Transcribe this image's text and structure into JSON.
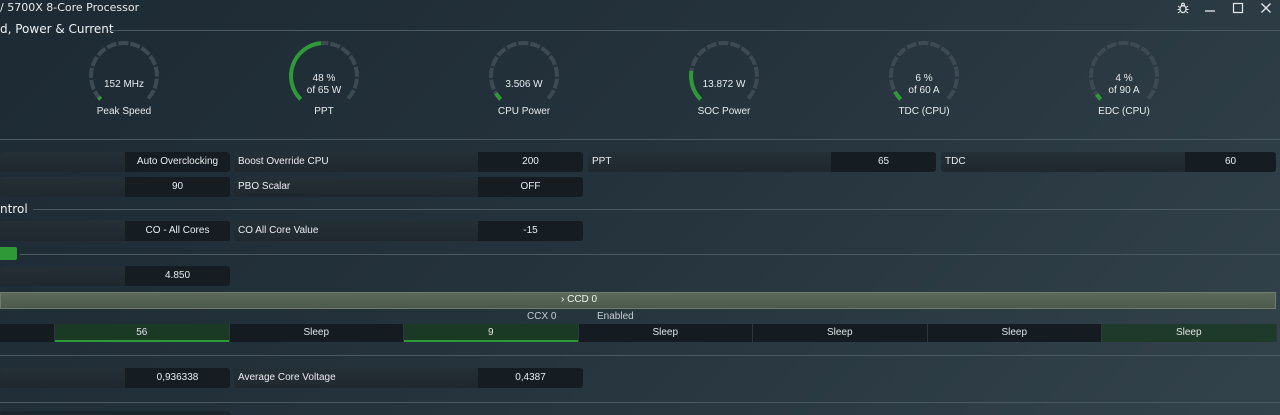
{
  "window": {
    "title": "/ 5700X 8-Core Processor",
    "icons": [
      "bug-icon",
      "minimize-icon",
      "maximize-icon",
      "close-icon"
    ]
  },
  "sections": {
    "speed_power": "d, Power & Current",
    "curve": "ntrol"
  },
  "gauges": [
    {
      "value": "152  MHz",
      "sub": "",
      "label": "Peak Speed",
      "fraction": 0.02
    },
    {
      "value": "48 %",
      "sub": "of 65 W",
      "label": "PPT",
      "fraction": 0.48
    },
    {
      "value": "3.506 W",
      "sub": "",
      "label": "CPU Power",
      "fraction": 0.05
    },
    {
      "value": "13.872 W",
      "sub": "",
      "label": "SOC Power",
      "fraction": 0.2
    },
    {
      "value": "6 %",
      "sub": "of 60 A",
      "label": "TDC (CPU)",
      "fraction": 0.06
    },
    {
      "value": "4 %",
      "sub": "of 90 A",
      "label": "EDC (CPU)",
      "fraction": 0.04
    }
  ],
  "rows": {
    "r1": {
      "auto_oc": "Auto Overclocking",
      "boost_label": "Boost Override CPU",
      "boost_value": "200",
      "ppt_label": "PPT",
      "ppt_value": "65",
      "tdc_label": "TDC",
      "tdc_value": "60"
    },
    "r2": {
      "left_value": "90",
      "pbo_label": "PBO Scalar",
      "pbo_value": "OFF"
    },
    "r3": {
      "co_mode": "CO - All Cores",
      "co_label": "CO All Core Value",
      "co_value": "-15"
    },
    "r4": {
      "enable_chip": "",
      "value": "4.850"
    },
    "r5": {
      "left_value": "0,936338",
      "avg_label": "Average Core Voltage",
      "avg_value": "0,4387"
    }
  },
  "ccd": {
    "title": "›  CCD 0",
    "ccx": "CCX 0",
    "status": "Enabled",
    "cores": [
      {
        "text": "",
        "load": 0
      },
      {
        "text": "56",
        "load": 1
      },
      {
        "text": "Sleep",
        "load": 0
      },
      {
        "text": "9",
        "load": 1
      },
      {
        "text": "Sleep",
        "load": 0
      },
      {
        "text": "Sleep",
        "load": 0
      },
      {
        "text": "Sleep",
        "load": 0
      },
      {
        "text": "Sleep",
        "load": 0
      }
    ]
  },
  "colors": {
    "accent": "#2e9a37",
    "track": "#3d4a52"
  }
}
